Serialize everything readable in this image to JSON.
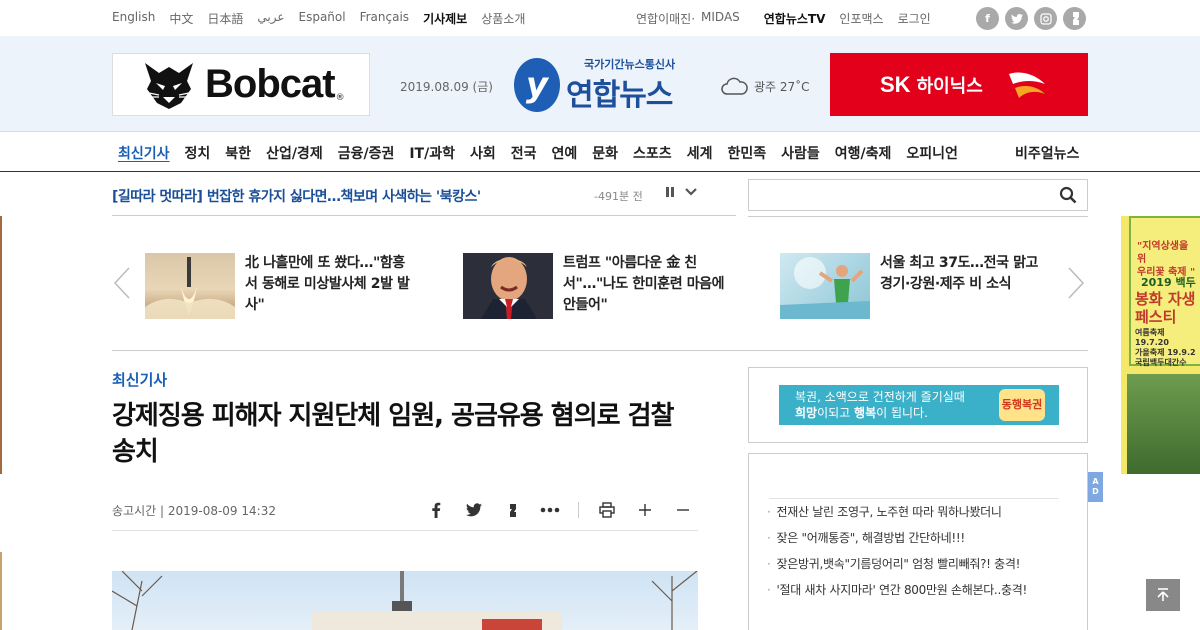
{
  "utility": {
    "languages": [
      "English",
      "中文",
      "日本語",
      "عربي",
      "Español",
      "Français"
    ],
    "report": "기사제보",
    "intro": "상품소개",
    "links": [
      "연합이매진·",
      "MIDAS"
    ],
    "tv": "연합뉴스TV",
    "infomax": "인포맥스",
    "login": "로그인",
    "socials": [
      "f",
      "t",
      "i",
      "s"
    ]
  },
  "header": {
    "left_ad_brand": "Bobcat",
    "left_ad_reg": "®",
    "date": "2019.08.09 (금)",
    "logo_sub": "국가기간뉴스통신사",
    "logo_main": "연합뉴스",
    "logo_mark": "y",
    "weather": "광주 27˚C",
    "weather_icon": "cloud-icon",
    "right_ad_brand": "SK",
    "right_ad_kr": "하이닉스"
  },
  "nav": {
    "items": [
      "최신기사",
      "정치",
      "북한",
      "산업/경제",
      "금융/증권",
      "IT/과학",
      "사회",
      "전국",
      "연예",
      "문화",
      "스포츠",
      "세계",
      "한민족",
      "사람들",
      "여행/축제",
      "오피니언"
    ],
    "visual": "비주얼뉴스"
  },
  "ticker": {
    "text": "[길따라 멋따라] 번잡한 휴가지 싫다면…책보며 사색하는 '북캉스'",
    "time": "-491분 전"
  },
  "search": {
    "placeholder": ""
  },
  "carousel": [
    {
      "text": "北 나흘만에 또 쐈다…\"함흥서 동해로 미상발사체 2발 발사\""
    },
    {
      "text": "트럼프 \"아름다운 金 친서\"…\"나도 한미훈련 마음에 안들어\""
    },
    {
      "text": "서울 최고 37도…전국 맑고 경기·강원·제주 비 소식"
    }
  ],
  "article": {
    "section": "최신기사",
    "headline": "강제징용 피해자 지원단체 임원, 공금유용 혐의로 검찰 송치",
    "meta": "송고시간 | 2019-08-09 14:32"
  },
  "sidebar": {
    "ad_line1": "복권, 소액으로 건전하게 즐기실때",
    "ad_line2a": "희망",
    "ad_line2b": "이되고 ",
    "ad_line2c": "행복",
    "ad_line2d": "이 됩니다.",
    "ad_logo": "동행복권",
    "list": [
      "전재산 날린 조영구, 노주현 따라 뭐하나봤더니",
      "잦은 \"어깨통증\", 해결방법 간단하네!!!",
      "잦은방귀,뱃속\"기름덩어리\" 엄청 빨리빼줘?! 충격!",
      "'절대 새차 사지마라' 연간 800만원 손해본다..충격!"
    ]
  },
  "vbanner": {
    "t1a": "\"지역상생을 위",
    "t1b": "우리꽃 축제 \"",
    "t2": "2019 백두",
    "t3a": "봉화 자생",
    "t3b": "페스티",
    "t4a": "여름축제 19.7.20",
    "t4b": "가을축제 19.9.2",
    "t4c": "국립백두대간수"
  },
  "ad_tag": [
    "A",
    "D"
  ]
}
